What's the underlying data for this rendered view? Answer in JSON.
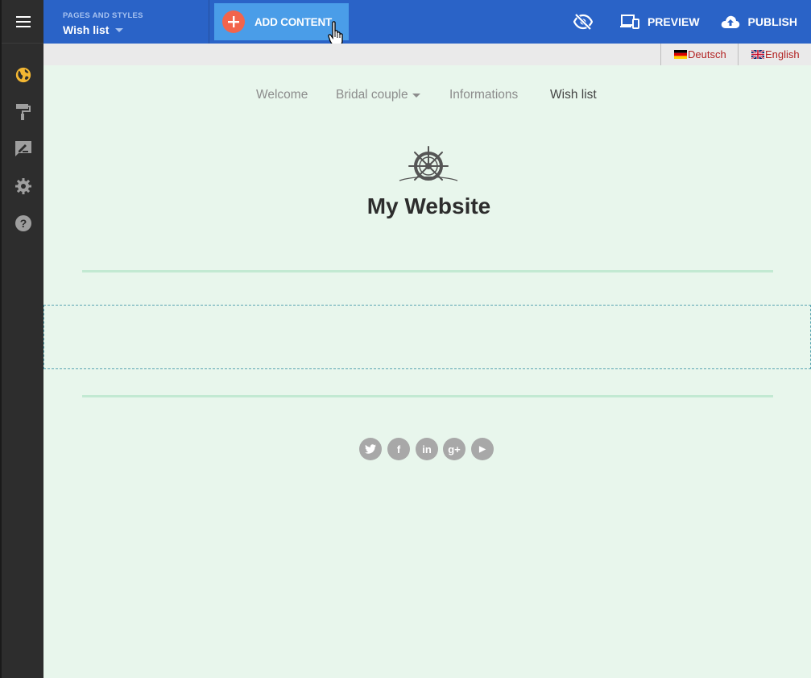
{
  "colors": {
    "topbar": "#2a63c7",
    "add_button": "#4a9de8",
    "add_plus": "#f2644c",
    "sidebar": "#2d2d2d",
    "active_sidebar_icon": "#f2b632",
    "page_background": "#e8f6ec",
    "lang_link": "#b22222"
  },
  "sidebar": {
    "items": [
      {
        "icon": "menu-icon"
      },
      {
        "icon": "globe-icon",
        "active": true
      },
      {
        "icon": "paint-roller-icon"
      },
      {
        "icon": "comment-edit-icon"
      },
      {
        "icon": "gear-icon"
      },
      {
        "icon": "help-icon"
      }
    ]
  },
  "topbar": {
    "pages_label": "PAGES AND STYLES",
    "current_page": "Wish list",
    "add_content_label": "ADD CONTENT",
    "preview_label": "PREVIEW",
    "publish_label": "PUBLISH"
  },
  "languages": [
    {
      "label": "Deutsch",
      "flag": "de"
    },
    {
      "label": "English",
      "flag": "gb"
    }
  ],
  "site": {
    "nav": [
      {
        "label": "Welcome",
        "active": false
      },
      {
        "label": "Bridal couple",
        "active": false,
        "has_dropdown": true
      },
      {
        "label": "Informations",
        "active": false
      },
      {
        "label": "Wish list",
        "active": true
      }
    ],
    "title": "My Website",
    "social": [
      {
        "icon": "twitter-icon",
        "glyph": "t"
      },
      {
        "icon": "facebook-icon",
        "glyph": "f"
      },
      {
        "icon": "linkedin-icon",
        "glyph": "in"
      },
      {
        "icon": "google-plus-icon",
        "glyph": "g+"
      },
      {
        "icon": "youtube-icon",
        "glyph": "▶"
      }
    ]
  }
}
